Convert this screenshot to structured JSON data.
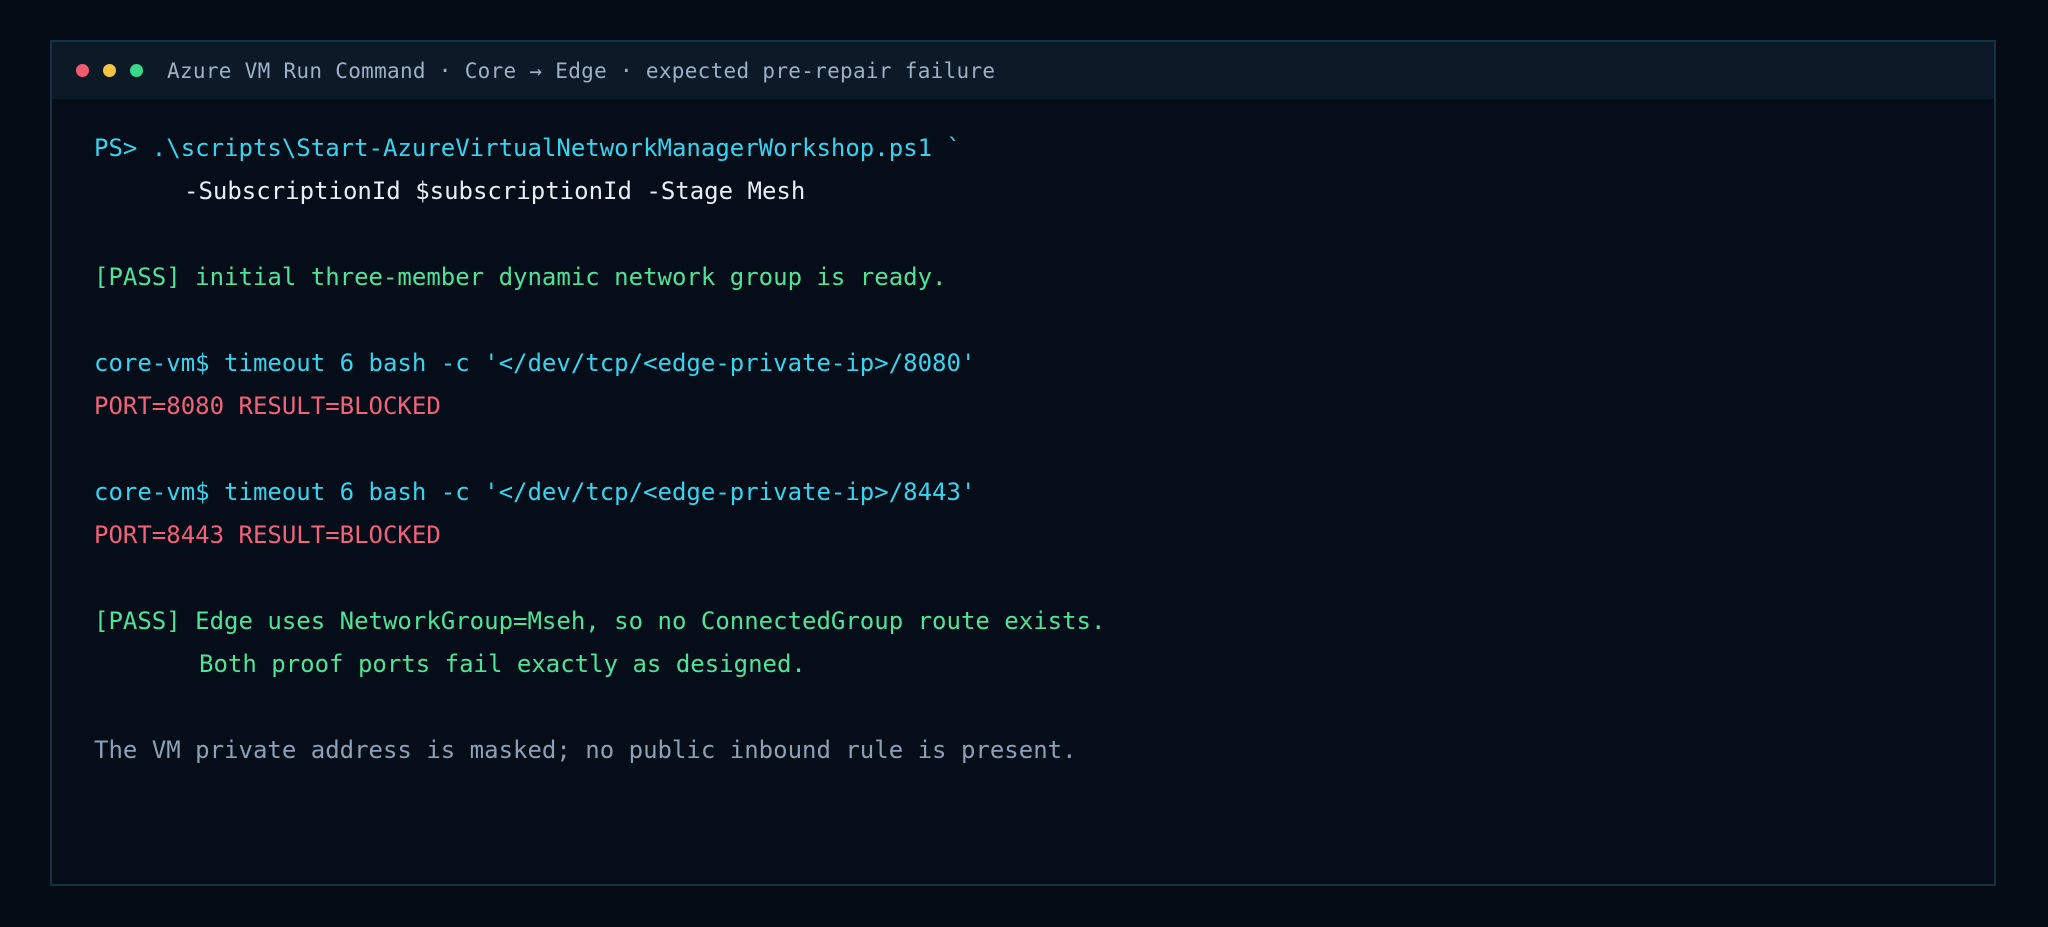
{
  "window": {
    "title": "Azure VM Run Command · Core → Edge · expected pre-repair failure",
    "controls": [
      "close",
      "minimize",
      "maximize"
    ]
  },
  "terminal": {
    "ps_command": "PS> .\\scripts\\Start-AzureVirtualNetworkManagerWorkshop.ps1 `",
    "ps_args": "-SubscriptionId $subscriptionId -Stage Mesh",
    "pass_initial": "[PASS] initial three-member dynamic network group is ready.",
    "probe1_command": "core-vm$ timeout 6 bash -c '</dev/tcp/<edge-private-ip>/8080'",
    "probe1_result": "PORT=8080 RESULT=BLOCKED",
    "probe2_command": "core-vm$ timeout 6 bash -c '</dev/tcp/<edge-private-ip>/8443'",
    "probe2_result": "PORT=8443 RESULT=BLOCKED",
    "pass_final_1": "[PASS] Edge uses NetworkGroup=Mseh, so no ConnectedGroup route exists.",
    "pass_final_2": "Both proof ports fail exactly as designed.",
    "footer_note": "The VM private address is masked; no public inbound rule is present."
  },
  "colors": {
    "background": "#060c16",
    "command": "#38d4ef",
    "argument": "#e8eef5",
    "pass": "#4fe39a",
    "fail": "#f2627a",
    "note": "#8da0b4"
  }
}
